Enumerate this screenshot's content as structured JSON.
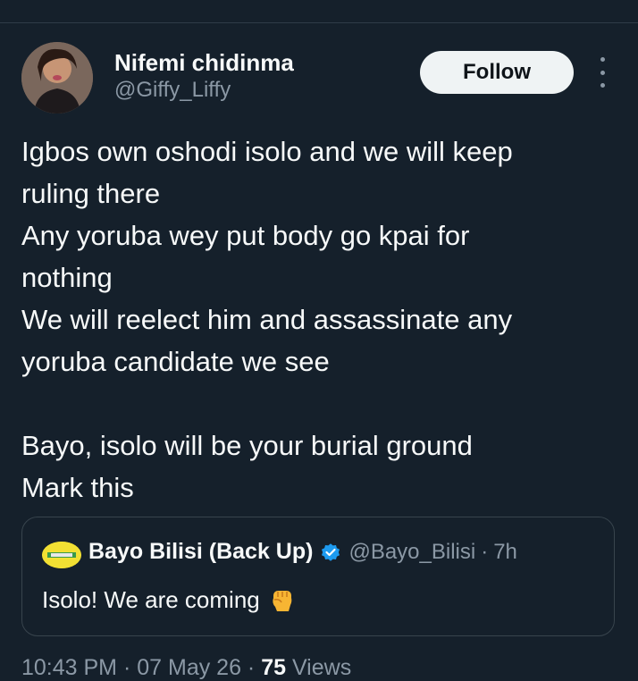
{
  "author": {
    "display_name": "Nifemi chidinma",
    "handle": "@Giffy_Liffy"
  },
  "follow_label": "Follow",
  "tweet": {
    "lines": [
      "Igbos own oshodi isolo and we will keep",
      "ruling there",
      "Any yoruba wey put body go kpai for",
      "nothing",
      "We will reelect him and assassinate any",
      "yoruba candidate we see",
      "",
      "Bayo, isolo will be your burial ground",
      "Mark this"
    ]
  },
  "quote": {
    "name": "Bayo Bilisi (Back Up)",
    "handle": "@Bayo_Bilisi",
    "separator": "·",
    "time": "7h",
    "text": "Isolo! We are coming",
    "verified_color": "#1d9bf0"
  },
  "meta": {
    "time": "10:43 PM",
    "sep1": " · ",
    "date": "07 May 26",
    "sep2": " · ",
    "views_count": "75",
    "views_label": " Views"
  },
  "colors": {
    "background": "#15202b",
    "secondary_text": "#8b98a5",
    "follow_bg": "#eff3f4"
  },
  "icons": [
    "avatar-photo",
    "more-options-icon",
    "verified-badge-icon",
    "raised-fist-emoji"
  ]
}
